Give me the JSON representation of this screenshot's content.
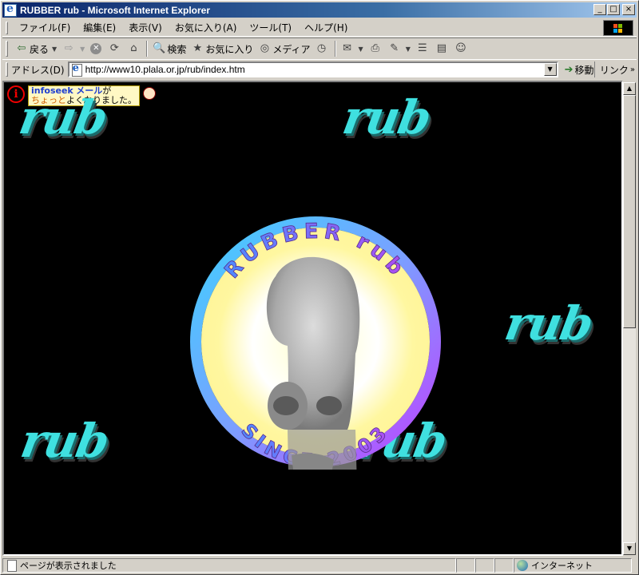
{
  "window": {
    "title": "RUBBER rub - Microsoft Internet Explorer",
    "controls": [
      "_",
      "□",
      "×"
    ]
  },
  "menu": [
    "ファイル(F)",
    "編集(E)",
    "表示(V)",
    "お気に入り(A)",
    "ツール(T)",
    "ヘルプ(H)"
  ],
  "toolbar": {
    "back": "戻る",
    "search": "検索",
    "favorites": "お気に入り",
    "media": "メディア"
  },
  "address": {
    "label": "アドレス(D)",
    "url": "http://www10.plala.or.jp/rub/index.htm",
    "go": "移動",
    "links": "リンク"
  },
  "ad": {
    "brand": "infoseek",
    "line1_rest": "メール",
    "line1_tail": "が",
    "line2_orange": "ちょっと",
    "line2_rest": "よくなりました。"
  },
  "page": {
    "logo_text": "rub",
    "emblem_top": "RUBBER rub",
    "emblem_bottom": "SINCE 2003"
  },
  "status": {
    "text": "ページが表示されました",
    "zone": "インターネット"
  },
  "colors": {
    "logo": "#3fe0e0",
    "ring_start": "#39c6ff",
    "ring_end": "#b84bff",
    "glow": "#fff9a0"
  }
}
